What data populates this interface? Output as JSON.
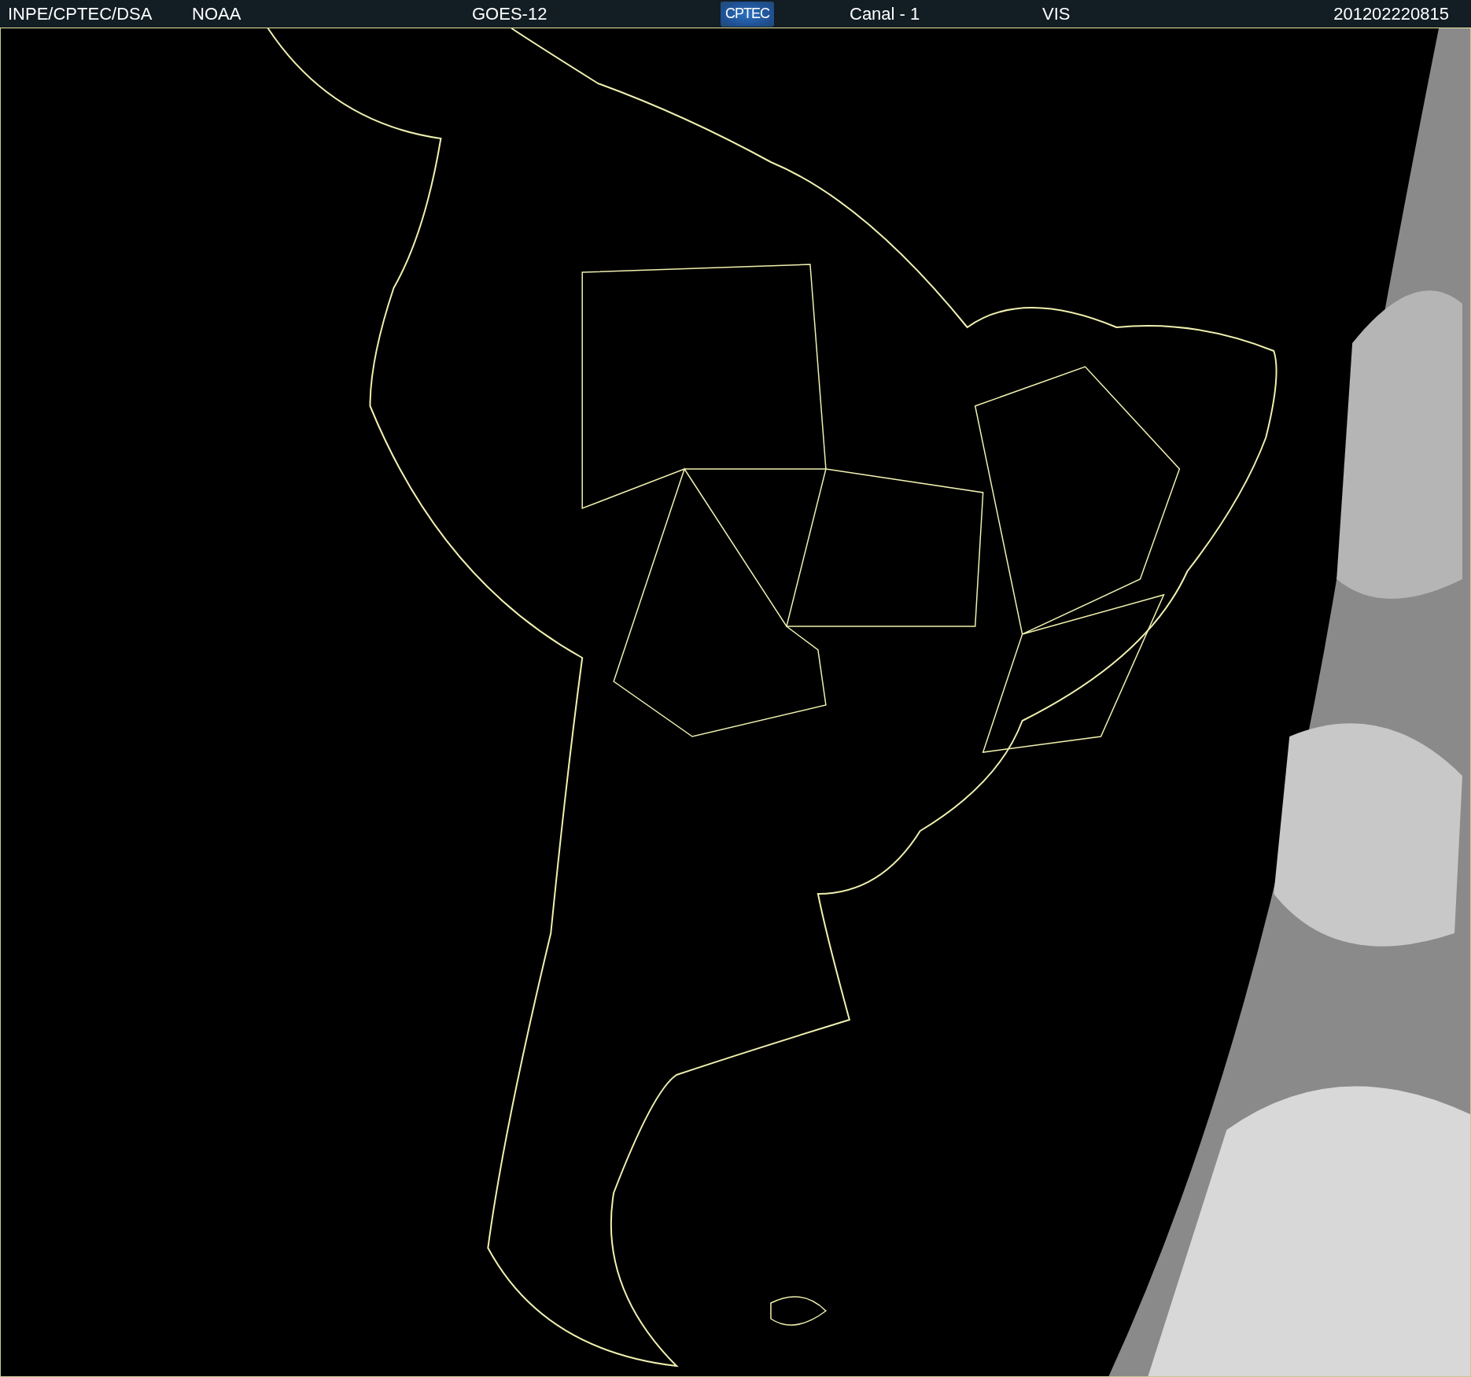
{
  "header": {
    "items": [
      {
        "kind": "text",
        "text": "INPE/CPTEC/DSA"
      },
      {
        "kind": "text",
        "text": "NOAA"
      },
      {
        "kind": "text",
        "text": "GOES-12"
      },
      {
        "kind": "logo",
        "text": "CPTEC"
      },
      {
        "kind": "text",
        "text": "Canal - 1"
      },
      {
        "kind": "text",
        "text": "VIS"
      },
      {
        "kind": "text",
        "text": "201202220815"
      }
    ]
  }
}
